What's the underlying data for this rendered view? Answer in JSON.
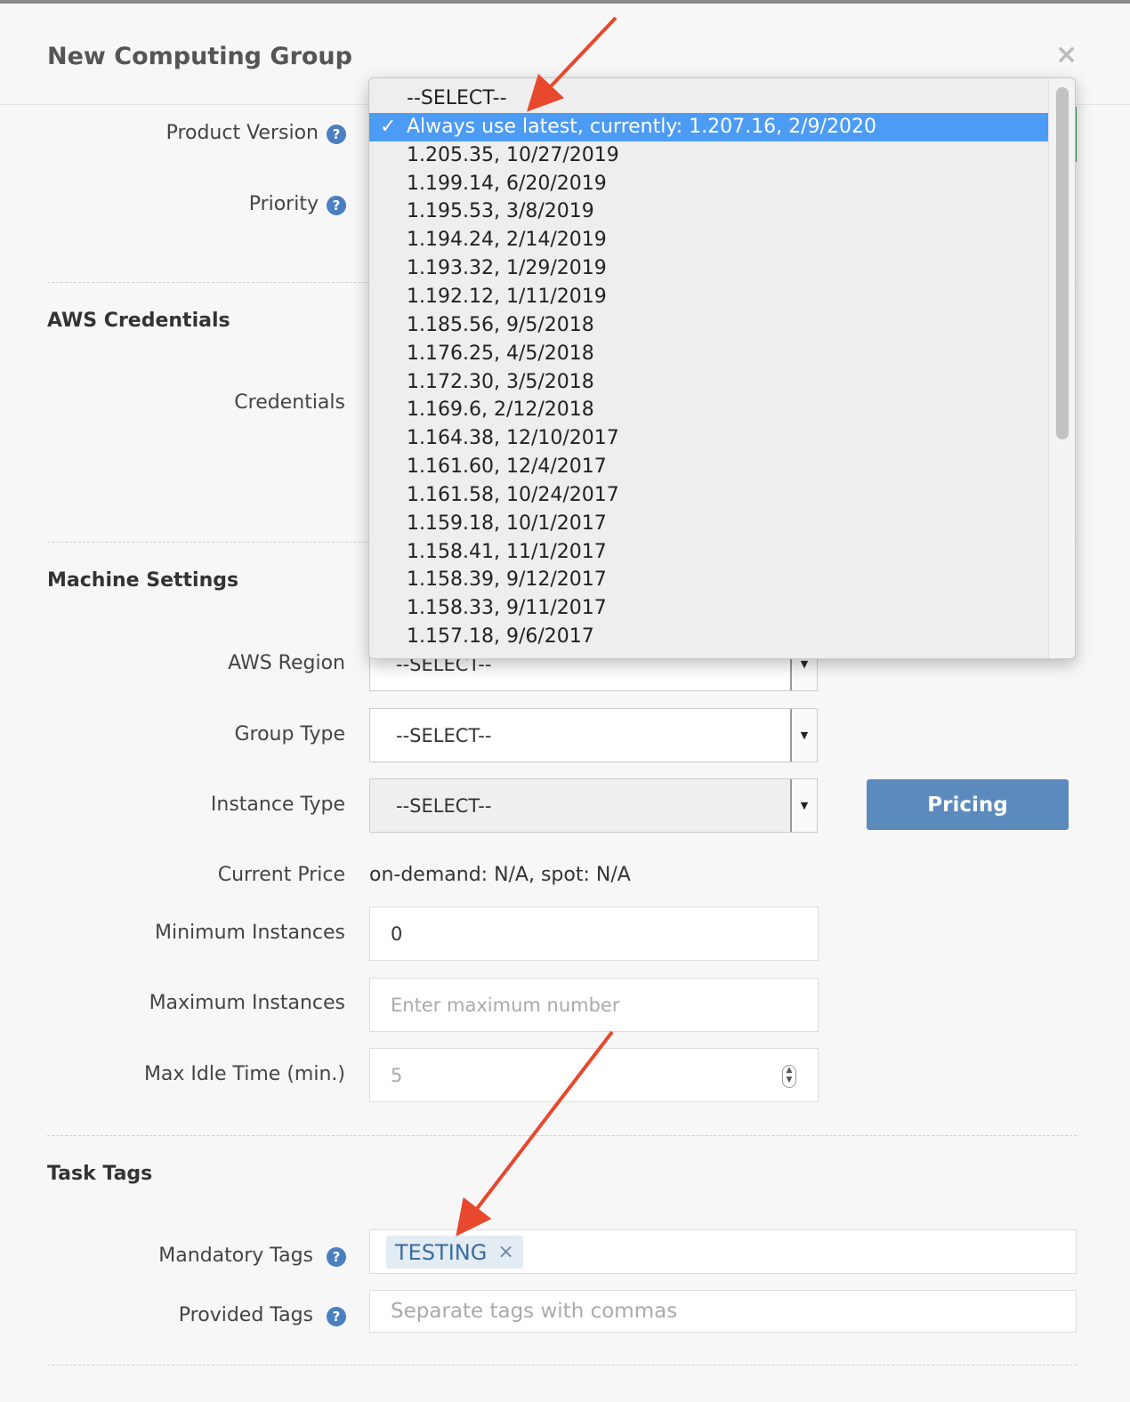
{
  "dialog": {
    "title": "New Computing Group",
    "close_symbol": "×"
  },
  "fields": {
    "product_version_label": "Product Version",
    "priority_label": "Priority",
    "credentials_label": "Credentials",
    "aws_region_label": "AWS Region",
    "aws_region_value": "--SELECT--",
    "group_type_label": "Group Type",
    "group_type_value": "--SELECT--",
    "instance_type_label": "Instance Type",
    "instance_type_value": "--SELECT--",
    "pricing_button": "Pricing",
    "current_price_label": "Current Price",
    "current_price_value": "on-demand: N/A, spot: N/A",
    "min_instances_label": "Minimum Instances",
    "min_instances_value": "0",
    "max_instances_label": "Maximum Instances",
    "max_instances_placeholder": "Enter maximum number",
    "max_idle_label": "Max Idle Time (min.)",
    "max_idle_placeholder": "5",
    "mandatory_tags_label": "Mandatory Tags",
    "mandatory_tag_chip": "TESTING",
    "mandatory_tag_remove": "×",
    "provided_tags_label": "Provided Tags",
    "provided_tags_placeholder": "Separate tags with commas",
    "help_symbol": "?"
  },
  "sections": {
    "aws_credentials": "AWS Credentials",
    "machine_settings": "Machine Settings",
    "task_tags": "Task Tags"
  },
  "dropdown": {
    "check_symbol": "✓",
    "selected_index": 1,
    "options": [
      "--SELECT--",
      "Always use latest, currently: 1.207.16, 2/9/2020",
      "1.205.35, 10/27/2019",
      "1.199.14, 6/20/2019",
      "1.195.53, 3/8/2019",
      "1.194.24, 2/14/2019",
      "1.193.32, 1/29/2019",
      "1.192.12, 1/11/2019",
      "1.185.56, 9/5/2018",
      "1.176.25, 4/5/2018",
      "1.172.30, 3/5/2018",
      "1.169.6, 2/12/2018",
      "1.164.38, 12/10/2017",
      "1.161.60, 12/4/2017",
      "1.161.58, 10/24/2017",
      "1.159.18, 10/1/2017",
      "1.158.41, 11/1/2017",
      "1.158.39, 9/12/2017",
      "1.158.33, 9/11/2017",
      "1.157.18, 9/6/2017"
    ]
  },
  "colors": {
    "selected_option": "#4c9bf5",
    "help_icon": "#4a7fc1",
    "pricing_button": "#5b8bbd",
    "annotation_arrow": "#e8482d",
    "tag_chip_bg": "#e3ebf3"
  }
}
